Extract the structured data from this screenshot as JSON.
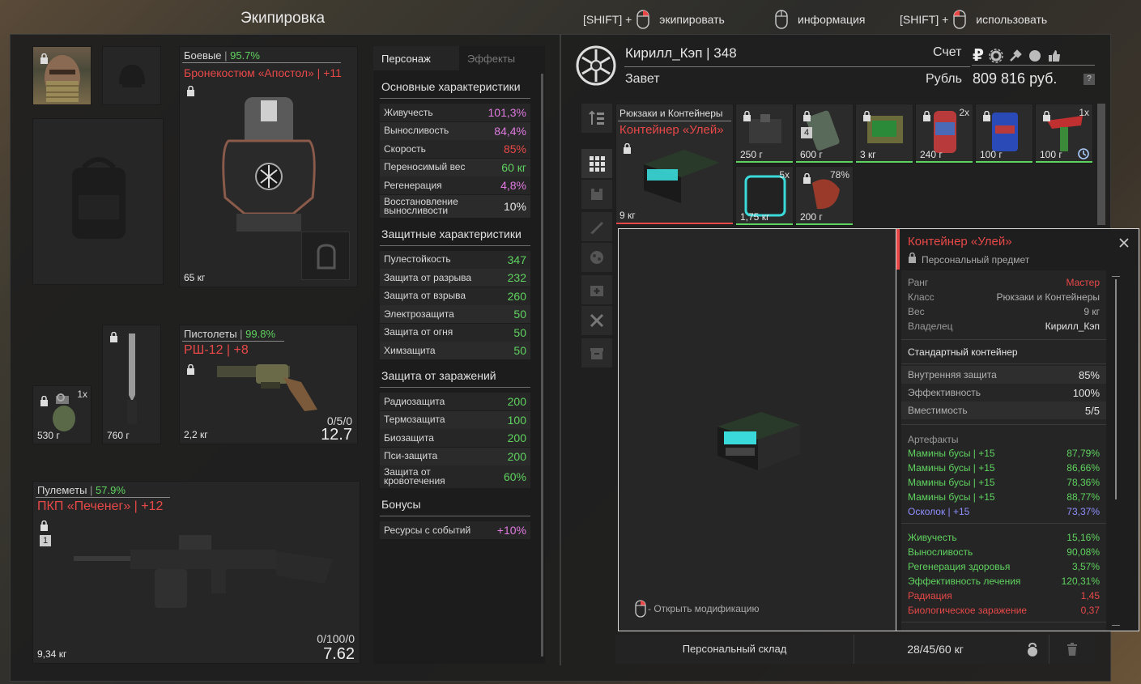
{
  "header": {
    "title": "Экипировка",
    "hint_equip_prefix": "[SHIFT] +",
    "hint_equip": "экипировать",
    "hint_info": "информация",
    "hint_use_prefix": "[SHIFT] +",
    "hint_use": "использовать"
  },
  "equipment": {
    "armor": {
      "category": "Боевые",
      "durability": "95.7%",
      "name": "Бронекостюм «Апостол» | +11",
      "weight": "65 кг"
    },
    "pistol": {
      "category": "Пистолеты",
      "durability": "99.8%",
      "name": "РШ-12 | +8",
      "weight": "2,2 кг",
      "ammo": "0/5/0",
      "caliber": "12.7"
    },
    "mg": {
      "category": "Пулеметы",
      "durability": "57.9%",
      "name": "ПКП «Печенег» | +12",
      "weight": "9,34 кг",
      "ammo": "0/100/0",
      "caliber": "7.62",
      "slot_num": "1"
    },
    "grenade": {
      "weight": "530 г",
      "count": "1x"
    },
    "knife": {
      "weight": "760 г"
    }
  },
  "tabs": {
    "character": "Персонаж",
    "effects": "Эффекты"
  },
  "stats": {
    "main_title": "Основные характеристики",
    "main": [
      {
        "label": "Живучесть",
        "value": "101,3%",
        "color": "pink"
      },
      {
        "label": "Выносливость",
        "value": "84,4%",
        "color": "pink"
      },
      {
        "label": "Скорость",
        "value": "85%",
        "color": "red"
      },
      {
        "label": "Переносимый вес",
        "value": "60 кг",
        "color": "green"
      },
      {
        "label": "Регенерация",
        "value": "4,8%",
        "color": "pink"
      },
      {
        "label": "Восстановление выносливости",
        "value": "10%",
        "color": "white"
      }
    ],
    "protect_title": "Защитные характеристики",
    "protect": [
      {
        "label": "Пулестойкость",
        "value": "347",
        "color": "green"
      },
      {
        "label": "Защита от разрыва",
        "value": "232",
        "color": "green"
      },
      {
        "label": "Защита от взрыва",
        "value": "260",
        "color": "green"
      },
      {
        "label": "Электрозащита",
        "value": "50",
        "color": "green"
      },
      {
        "label": "Защита от огня",
        "value": "50",
        "color": "green"
      },
      {
        "label": "Химзащита",
        "value": "50",
        "color": "green"
      }
    ],
    "infect_title": "Защита от заражений",
    "infect": [
      {
        "label": "Радиозащита",
        "value": "200",
        "color": "green"
      },
      {
        "label": "Термозащита",
        "value": "100",
        "color": "green"
      },
      {
        "label": "Биозащита",
        "value": "200",
        "color": "green"
      },
      {
        "label": "Пси-защита",
        "value": "200",
        "color": "green"
      },
      {
        "label": "Защита от кровотечения",
        "value": "60%",
        "color": "green"
      }
    ],
    "bonus_title": "Бонусы",
    "bonus": [
      {
        "label": "Ресурсы с событий",
        "value": "+10%",
        "color": "pink"
      }
    ]
  },
  "player": {
    "name": "Кирилл_Кэп | 348",
    "faction": "Завет",
    "account_label": "Счет",
    "currency_label": "Рубль",
    "money": "809 816 руб.",
    "help": "?"
  },
  "stash": {
    "category": "Рюкзаки и Контейнеры",
    "selected_name": "Контейнер «Улей»",
    "selected_weight": "9 кг",
    "items": [
      {
        "weight": "250 г",
        "count": "",
        "locked": true
      },
      {
        "weight": "600 г",
        "count": "",
        "locked": true,
        "badge": "4"
      },
      {
        "weight": "3 кг",
        "count": "",
        "locked": true
      },
      {
        "weight": "240 г",
        "count": "2x",
        "locked": true
      },
      {
        "weight": "100 г",
        "count": "",
        "locked": true
      },
      {
        "weight": "100 г",
        "count": "1x",
        "locked": true
      },
      {
        "weight": "1,75 кг",
        "count": "5x",
        "locked": false
      },
      {
        "weight": "200 г",
        "count": "78%",
        "locked": true
      }
    ],
    "footer_label": "Персональный склад",
    "footer_weight": "28/45/60 кг"
  },
  "tooltip": {
    "title": "Контейнер «Улей»",
    "subtitle": "Персональный предмет",
    "info": [
      {
        "label": "Ранг",
        "value": "Мастер",
        "color": "red"
      },
      {
        "label": "Класс",
        "value": "Рюкзаки и Контейнеры",
        "color": "grey"
      },
      {
        "label": "Вес",
        "value": "9 кг",
        "color": "grey"
      },
      {
        "label": "Владелец",
        "value": "Кирилл_Кэп",
        "color": "white"
      }
    ],
    "description": "Стандартный контейнер",
    "props": [
      {
        "label": "Внутренняя защита",
        "value": "85%"
      },
      {
        "label": "Эффективность",
        "value": "100%"
      },
      {
        "label": "Вместимость",
        "value": "5/5"
      }
    ],
    "artifacts_title": "Артефакты",
    "artifacts": [
      {
        "label": "Мамины бусы | +15",
        "value": "87,79%",
        "color": "green"
      },
      {
        "label": "Мамины бусы | +15",
        "value": "86,66%",
        "color": "green"
      },
      {
        "label": "Мамины бусы | +15",
        "value": "78,36%",
        "color": "green"
      },
      {
        "label": "Мамины бусы | +15",
        "value": "88,77%",
        "color": "green"
      },
      {
        "label": "Осколок | +15",
        "value": "73,37%",
        "color": "blue"
      }
    ],
    "effects": [
      {
        "label": "Живучесть",
        "value": "15,16%",
        "color": "green"
      },
      {
        "label": "Выносливость",
        "value": "90,08%",
        "color": "green"
      },
      {
        "label": "Регенерация здоровья",
        "value": "3,57%",
        "color": "green"
      },
      {
        "label": "Эффективность лечения",
        "value": "120,31%",
        "color": "green"
      },
      {
        "label": "Радиация",
        "value": "1,45",
        "color": "red"
      },
      {
        "label": "Биологическое заражение",
        "value": "0,37",
        "color": "red"
      }
    ],
    "mod_hint": "- Открыть модификацию"
  }
}
